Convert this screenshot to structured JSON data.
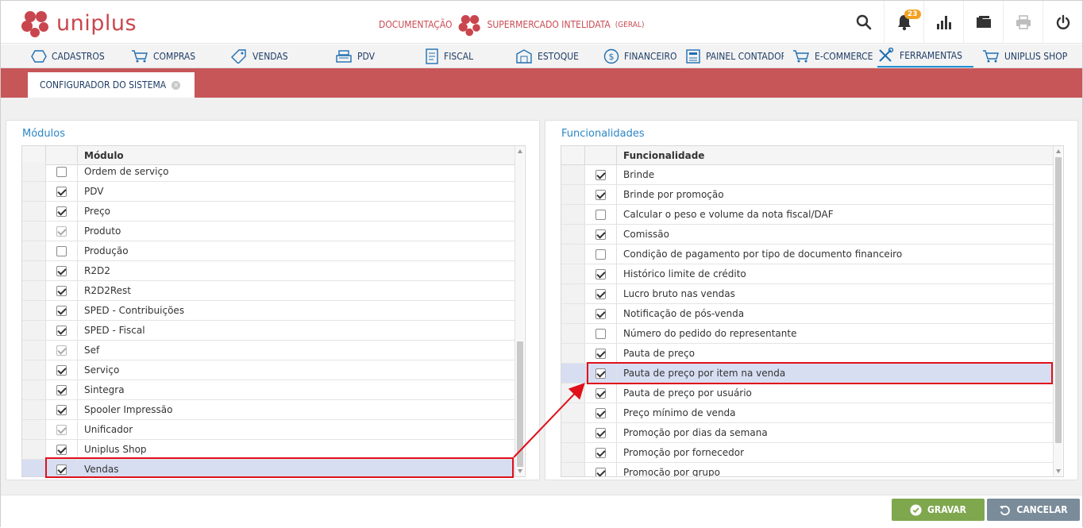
{
  "header": {
    "logo_text": "uniplus",
    "doc_label": "DOCUMENTAÇÃO",
    "company": "SUPERMERCADO INTELIDATA",
    "company_sub": "(GERAL)",
    "notifications_count": "23"
  },
  "nav": {
    "items": [
      {
        "label": "CADASTROS",
        "icon": "cube-icon"
      },
      {
        "label": "COMPRAS",
        "icon": "cart-icon"
      },
      {
        "label": "VENDAS",
        "icon": "tag-icon"
      },
      {
        "label": "PDV",
        "icon": "register-icon"
      },
      {
        "label": "FISCAL",
        "icon": "document-icon"
      },
      {
        "label": "ESTOQUE",
        "icon": "warehouse-icon"
      },
      {
        "label": "FINANCEIRO",
        "icon": "dollar-icon"
      },
      {
        "label": "PAINEL CONTADOR",
        "icon": "calculator-icon"
      },
      {
        "label": "E-COMMERCE",
        "icon": "cart-icon"
      },
      {
        "label": "FERRAMENTAS",
        "icon": "tools-icon"
      },
      {
        "label": "UNIPLUS SHOP",
        "icon": "cart-icon"
      }
    ],
    "active": "FERRAMENTAS"
  },
  "tab": {
    "label": "CONFIGURADOR DO SISTEMA"
  },
  "modules": {
    "title": "Módulos",
    "column": "Módulo",
    "rows": [
      {
        "label": "Ordem de serviço",
        "checked": false,
        "disabled": false
      },
      {
        "label": "PDV",
        "checked": true,
        "disabled": false
      },
      {
        "label": "Preço",
        "checked": true,
        "disabled": false
      },
      {
        "label": "Produto",
        "checked": true,
        "disabled": true
      },
      {
        "label": "Produção",
        "checked": false,
        "disabled": false
      },
      {
        "label": "R2D2",
        "checked": true,
        "disabled": false
      },
      {
        "label": "R2D2Rest",
        "checked": true,
        "disabled": false
      },
      {
        "label": "SPED - Contribuições",
        "checked": true,
        "disabled": false
      },
      {
        "label": "SPED - Fiscal",
        "checked": true,
        "disabled": false
      },
      {
        "label": "Sef",
        "checked": true,
        "disabled": true
      },
      {
        "label": "Serviço",
        "checked": true,
        "disabled": false
      },
      {
        "label": "Sintegra",
        "checked": true,
        "disabled": false
      },
      {
        "label": "Spooler Impressão",
        "checked": true,
        "disabled": false
      },
      {
        "label": "Unificador",
        "checked": true,
        "disabled": true
      },
      {
        "label": "Uniplus Shop",
        "checked": true,
        "disabled": false
      },
      {
        "label": "Vendas",
        "checked": true,
        "disabled": false,
        "selected": true
      }
    ]
  },
  "features": {
    "title": "Funcionalidades",
    "column": "Funcionalidade",
    "rows": [
      {
        "label": "Brinde",
        "checked": true
      },
      {
        "label": "Brinde por promoção",
        "checked": true
      },
      {
        "label": "Calcular o peso e volume da nota fiscal/DAF",
        "checked": false
      },
      {
        "label": "Comissão",
        "checked": true
      },
      {
        "label": "Condição de pagamento por tipo de documento financeiro",
        "checked": false
      },
      {
        "label": "Histórico limite de crédito",
        "checked": true
      },
      {
        "label": "Lucro bruto nas vendas",
        "checked": true
      },
      {
        "label": "Notificação de pós-venda",
        "checked": true
      },
      {
        "label": "Número do pedido do representante",
        "checked": false
      },
      {
        "label": "Pauta de preço",
        "checked": true
      },
      {
        "label": "Pauta de preço por item na venda",
        "checked": true,
        "selected": true
      },
      {
        "label": "Pauta de preço por usuário",
        "checked": true
      },
      {
        "label": "Preço mínimo de venda",
        "checked": true
      },
      {
        "label": "Promoção por dias da semana",
        "checked": true
      },
      {
        "label": "Promoção por fornecedor",
        "checked": true
      },
      {
        "label": "Promoção por grupo",
        "checked": true
      }
    ]
  },
  "footer": {
    "save_label": "GRAVAR",
    "cancel_label": "CANCELAR"
  },
  "colors": {
    "brand": "#c9464e",
    "accent": "#2b86c5",
    "save": "#7fa74e",
    "cancel": "#7a8b99",
    "highlight": "#e0101a"
  }
}
